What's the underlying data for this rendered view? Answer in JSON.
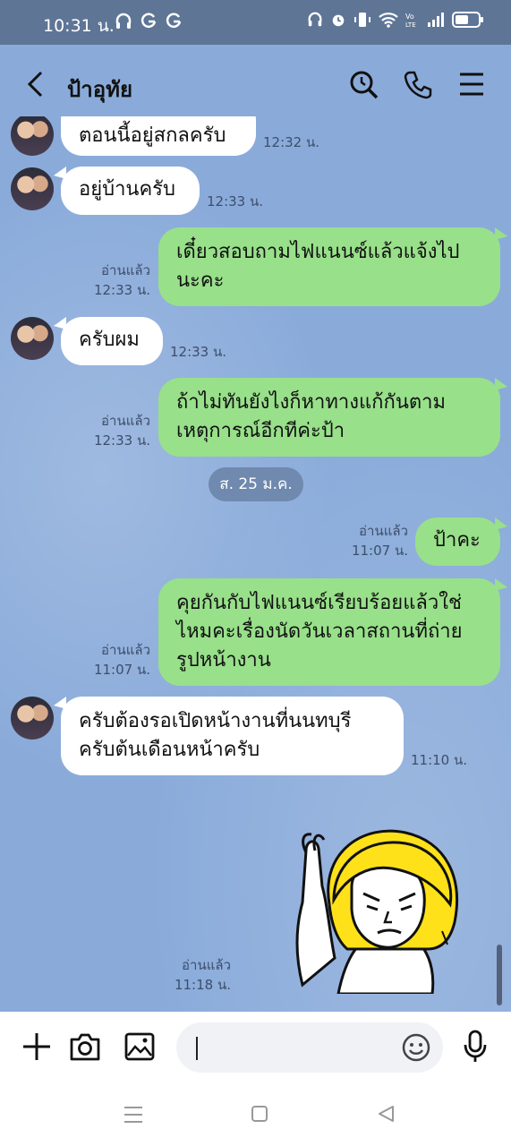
{
  "status_bar": {
    "time": "10:31 น.",
    "battery": "battery-icon"
  },
  "header": {
    "title": "ป้าอุทัย"
  },
  "messages": [
    {
      "side": "in",
      "text": "ตอนนี้อยู่สกลครับ",
      "time": "12:32 น."
    },
    {
      "side": "in",
      "text": "อยู่บ้านครับ",
      "time": "12:33 น."
    },
    {
      "side": "out",
      "lines": [
        "เดี๋ยวสอบถามไฟแนนซ์แล้วแจ้งไป",
        "นะคะ"
      ],
      "read": "อ่านแล้ว",
      "time": "12:33 น."
    },
    {
      "side": "in",
      "text": "ครับผม",
      "time": "12:33 น."
    },
    {
      "side": "out",
      "lines": [
        "ถ้าไม่ทันยังไงก็หาทางแก้กันตาม",
        "เหตุการณ์อีกทีค่ะป้า"
      ],
      "read": "อ่านแล้ว",
      "time": "12:33 น."
    },
    {
      "side": "out",
      "text": "ป้าคะ",
      "read": "อ่านแล้ว",
      "time": "11:07 น."
    },
    {
      "side": "out",
      "lines": [
        "คุยกันกับไฟแนนซ์เรียบร้อยแล้วใช่",
        "ไหมคะเรื่องนัดวันเวลาสถานที่ถ่าย",
        "รูปหน้างาน"
      ],
      "read": "อ่านแล้ว",
      "time": "11:07 น."
    },
    {
      "side": "in",
      "lines": [
        "ครับต้องรอเปิดหน้างานที่นนทบุรี",
        "ครับต้นเดือนหน้าครับ"
      ],
      "time": "11:10 น."
    },
    {
      "side": "out",
      "sticker": "sticker-blonde-character",
      "read": "อ่านแล้ว",
      "time": "11:18 น."
    }
  ],
  "date_separator": "ส. 25 ม.ค.",
  "input": {
    "placeholder": ""
  }
}
